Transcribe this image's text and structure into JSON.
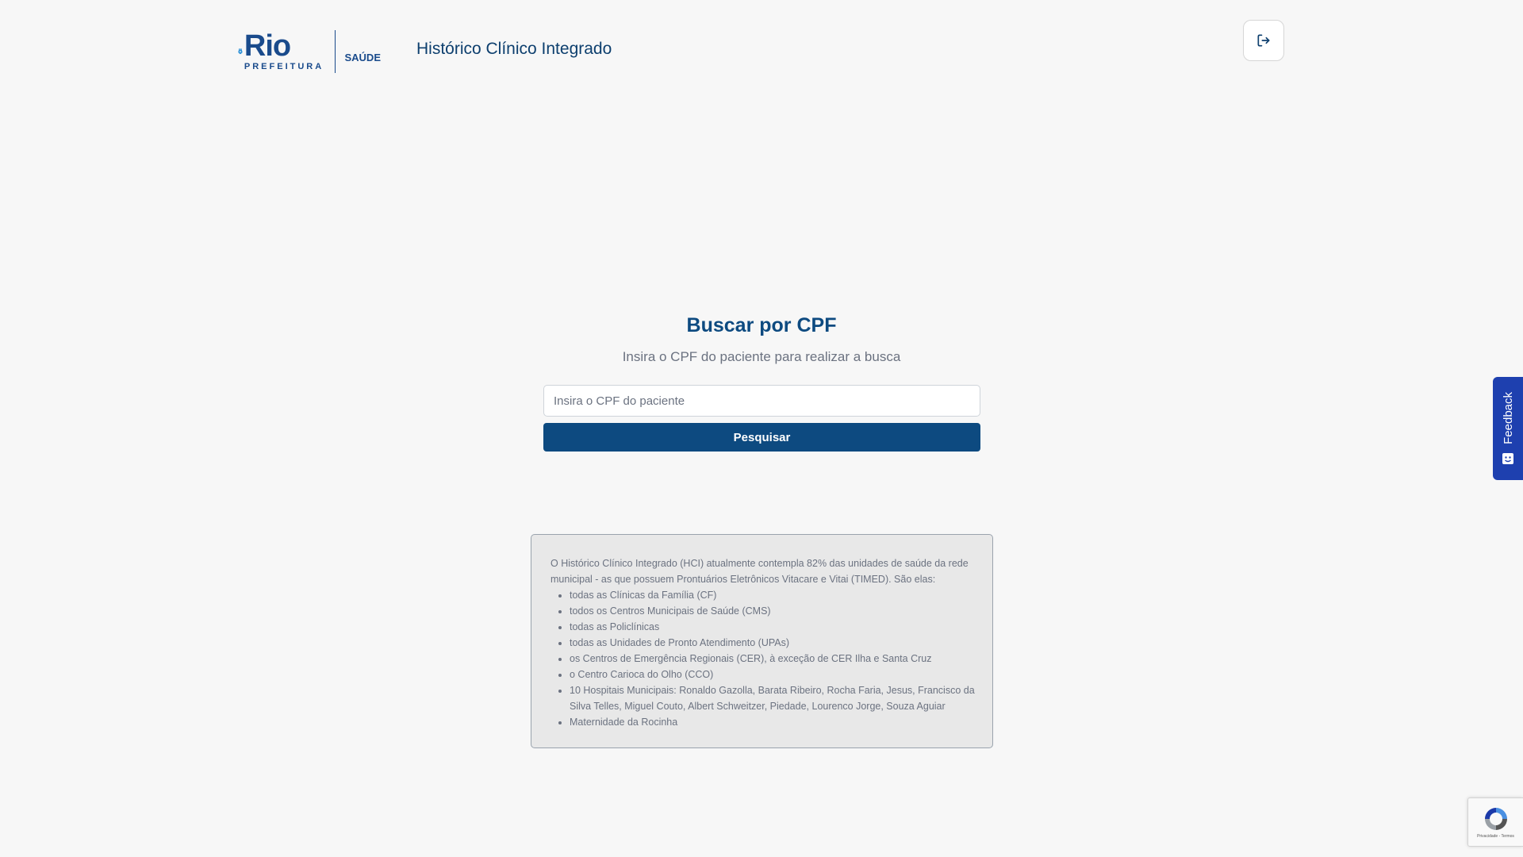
{
  "header": {
    "logo": {
      "brand": "Rio",
      "subbrand": "PREFEITURA",
      "department": "SAÚDE"
    },
    "app_title": "Histórico Clínico Integrado",
    "logout_icon": "logout-icon"
  },
  "search": {
    "title": "Buscar por CPF",
    "subtitle": "Insira o CPF do paciente para realizar a busca",
    "input_placeholder": "Insira o CPF do paciente",
    "input_value": "",
    "button_label": "Pesquisar"
  },
  "info": {
    "intro": "O Histórico Clínico Integrado (HCI) atualmente contempla 82% das unidades de saúde da rede municipal - as que possuem Prontuários Eletrônicos Vitacare e Vitai (TIMED). São elas:",
    "items": [
      "todas as Clínicas da Família (CF)",
      "todos os Centros Municipais de Saúde (CMS)",
      "todas as Policlínicas",
      "todas as Unidades de Pronto Atendimento (UPAs)",
      "os Centros de Emergência Regionais (CER), à exceção de CER Ilha e Santa Cruz",
      "o Centro Carioca do Olho (CCO)",
      "10 Hospitais Municipais: Ronaldo Gazolla, Barata Ribeiro, Rocha Faria, Jesus, Francisco da Silva Telles, Miguel Couto, Albert Schweitzer, Piedade, Lourenco Jorge, Souza Aguiar",
      "Maternidade da Rocinha"
    ]
  },
  "feedback": {
    "label": "Feedback",
    "icon": "feedback-icon"
  },
  "recaptcha": {
    "terms": "Privacidade - Termos"
  },
  "colors": {
    "primary": "#0d4a80",
    "feedback": "#1e40af",
    "background": "#f7f7f7"
  }
}
